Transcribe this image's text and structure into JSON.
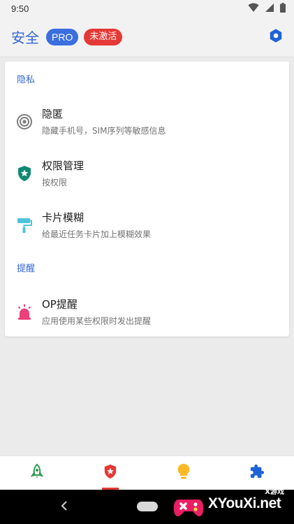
{
  "status_bar": {
    "time": "9:50"
  },
  "app_bar": {
    "title": "安全",
    "pro_badge": "PRO",
    "inactive_badge": "未激活",
    "settings_icon": "hexagon-gear-icon"
  },
  "sections": [
    {
      "header": "隐私",
      "items": [
        {
          "title": "隐匿",
          "subtitle": "隐藏手机号，SIM序列等敏感信息",
          "icon": "target-icon"
        },
        {
          "title": "权限管理",
          "subtitle": "按权限",
          "icon": "shield-star-icon"
        },
        {
          "title": "卡片模糊",
          "subtitle": "给最近任务卡片加上模糊效果",
          "icon": "paint-roller-icon"
        }
      ]
    },
    {
      "header": "提醒",
      "items": [
        {
          "title": "OP提醒",
          "subtitle": "应用使用某些权限时发出提醒",
          "icon": "alarm-light-icon"
        }
      ]
    }
  ],
  "bottom_nav": [
    {
      "name": "rocket-icon",
      "active": false
    },
    {
      "name": "shield-star-icon",
      "active": true
    },
    {
      "name": "lightbulb-icon",
      "active": false
    },
    {
      "name": "puzzle-icon",
      "active": false
    }
  ],
  "watermark": {
    "text": "XYouXi.net",
    "sub": "X游戏"
  },
  "colors": {
    "accent": "#3367d6",
    "pro_badge": "#3b6fe0",
    "inactive_badge": "#e53935",
    "shield_green": "#0f8a72",
    "roller_cyan": "#4fc3dc",
    "alarm_pink": "#ec407a",
    "bulb_yellow": "#f9b825",
    "puzzle_blue": "#1e63d6",
    "rocket_green": "#2e9b4e"
  }
}
